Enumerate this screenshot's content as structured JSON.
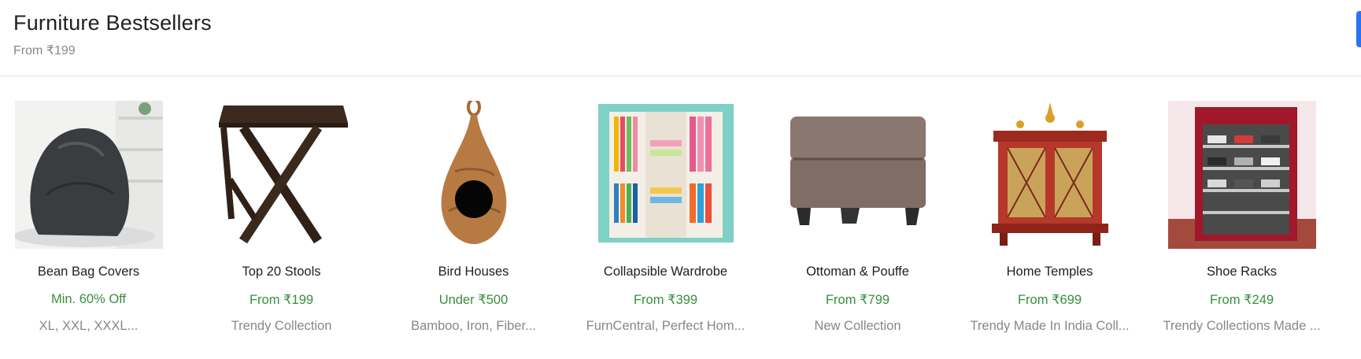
{
  "section": {
    "title": "Furniture Bestsellers",
    "subtitle": "From ₹199"
  },
  "products": [
    {
      "name": "Bean Bag Covers",
      "offer": "Min. 60% Off",
      "desc": "XL, XXL, XXXL...",
      "image": "bean-bag-image"
    },
    {
      "name": "Top 20 Stools",
      "offer": "From ₹199",
      "desc": "Trendy Collection",
      "image": "folding-stool-image"
    },
    {
      "name": "Bird Houses",
      "offer": "Under ₹500",
      "desc": "Bamboo, Iron, Fiber...",
      "image": "bird-house-image"
    },
    {
      "name": "Collapsible Wardrobe",
      "offer": "From ₹399",
      "desc": "FurnCentral, Perfect Hom...",
      "image": "wardrobe-image"
    },
    {
      "name": "Ottoman & Pouffe",
      "offer": "From ₹799",
      "desc": "New Collection",
      "image": "ottoman-image"
    },
    {
      "name": "Home Temples",
      "offer": "From ₹699",
      "desc": "Trendy Made In India Coll...",
      "image": "home-temple-image"
    },
    {
      "name": "Shoe Racks",
      "offer": "From ₹249",
      "desc": "Trendy Collections Made ...",
      "image": "shoe-rack-image"
    }
  ],
  "colors": {
    "offer_green": "#388e3c",
    "desc_gray": "#878787",
    "accent_blue": "#2874f0"
  }
}
